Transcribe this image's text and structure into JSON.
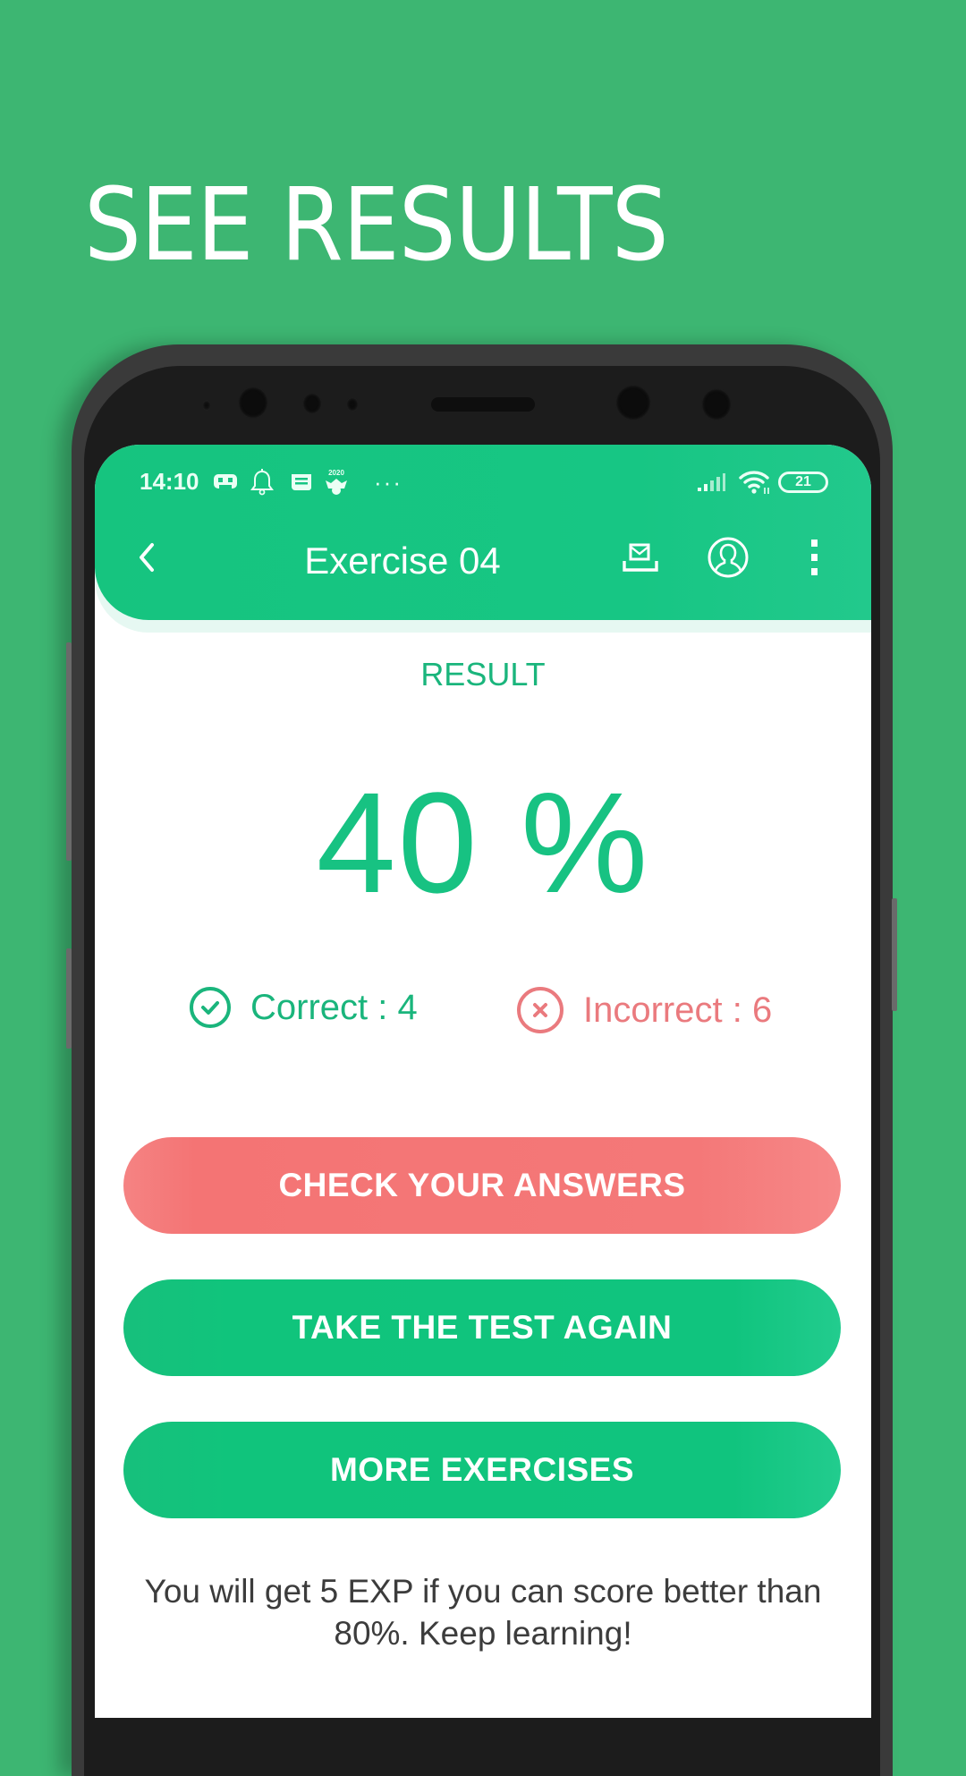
{
  "promo": {
    "headline": "SEE RESULTS"
  },
  "colors": {
    "background": "#3db672",
    "accent_green": "#17c282",
    "accent_red": "#f47676",
    "text_dark": "#3c3c3c"
  },
  "status_bar": {
    "time": "14:10",
    "left_icons": [
      "gamepad-icon",
      "bell-icon",
      "news-icon",
      "badge-2020-icon",
      "more-dots-icon"
    ],
    "badge_text": "2020",
    "more_dots": "···",
    "right_icons": [
      "signal-icon",
      "wifi-icon",
      "battery-icon"
    ],
    "battery_level": "21"
  },
  "toolbar": {
    "back_icon": "chevron-left-icon",
    "title": "Exercise 04",
    "actions": [
      "inbox-icon",
      "account-icon",
      "more-vert-icon"
    ]
  },
  "result": {
    "label": "RESULT",
    "score": "40 %",
    "correct_label": "Correct : 4",
    "incorrect_label": "Incorrect : 6",
    "correct_count": 4,
    "incorrect_count": 6
  },
  "buttons": {
    "check_answers": "CHECK YOUR ANSWERS",
    "take_again": "TAKE THE TEST AGAIN",
    "more_exercises": "MORE EXERCISES"
  },
  "footer_note": "You will get 5 EXP if you can score better than 80%. Keep learning!"
}
